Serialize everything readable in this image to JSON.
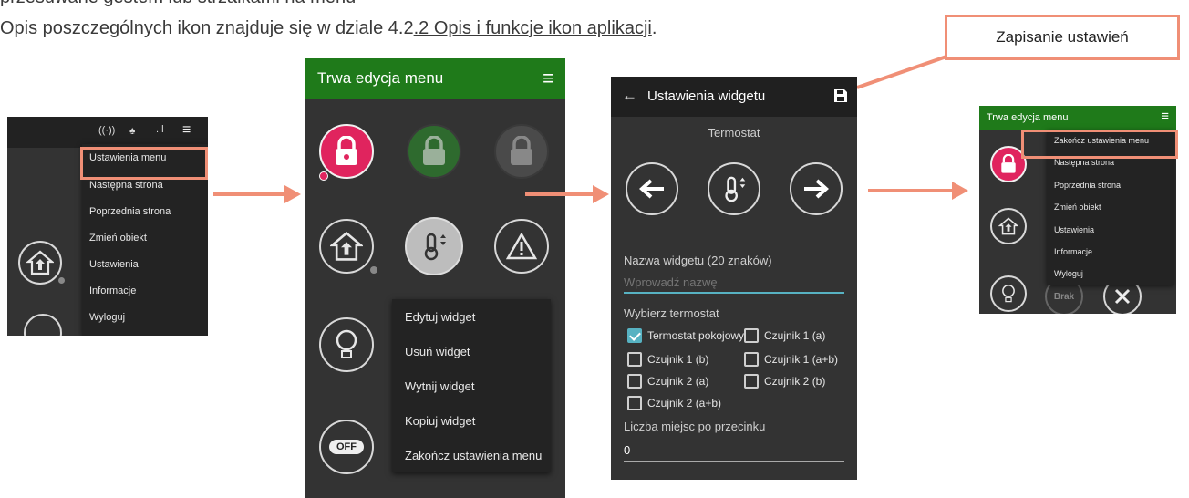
{
  "doc": {
    "line1": "przesuwane gestem lub strzałkami na menu",
    "line2_prefix": "Opis poszczególnych ikon znajduje się w dziale 4.2",
    "line2_link": ".2 Opis i funkcje ikon aplikacji",
    "line2_suffix": ".",
    "callout": "Zapisanie ustawień"
  },
  "screen1": {
    "menu": [
      "Ustawienia menu",
      "Następna strona",
      "Poprzednia strona",
      "Zmień obiekt",
      "Ustawienia",
      "Informacje",
      "Wyloguj"
    ]
  },
  "screen2": {
    "title": "Trwa edycja menu",
    "context_menu": [
      "Edytuj widget",
      "Usuń widget",
      "Wytnij widget",
      "Kopiuj widget",
      "Zakończ ustawienia menu"
    ],
    "off_label": "OFF"
  },
  "screen3": {
    "title": "Ustawienia widgetu",
    "subtitle": "Termostat",
    "name_label": "Nazwa widgetu (20 znaków)",
    "name_placeholder": "Wprowadź nazwę",
    "choose_label": "Wybierz termostat",
    "options": [
      "Termostat pokojowy",
      "Czujnik 1 (a)",
      "Czujnik 1 (b)",
      "Czujnik 1 (a+b)",
      "Czujnik 2 (a)",
      "Czujnik 2 (b)",
      "Czujnik 2 (a+b)"
    ],
    "checked": [
      true,
      false,
      false,
      false,
      false,
      false,
      false
    ],
    "decimals_label": "Liczba miejsc po przecinku",
    "decimals_value": "0"
  },
  "screen4": {
    "title": "Trwa edycja menu",
    "menu": [
      "Zakończ ustawienia menu",
      "Następna strona",
      "Poprzednia strona",
      "Zmień obiekt",
      "Ustawienia",
      "Informacje",
      "Wyloguj"
    ],
    "brak_label": "Brak"
  },
  "colors": {
    "accent": "#f08f76",
    "green": "#1f7a1a",
    "phone_bg": "#333333",
    "checkbox": "#57b2c2",
    "red": "#e0245e"
  }
}
